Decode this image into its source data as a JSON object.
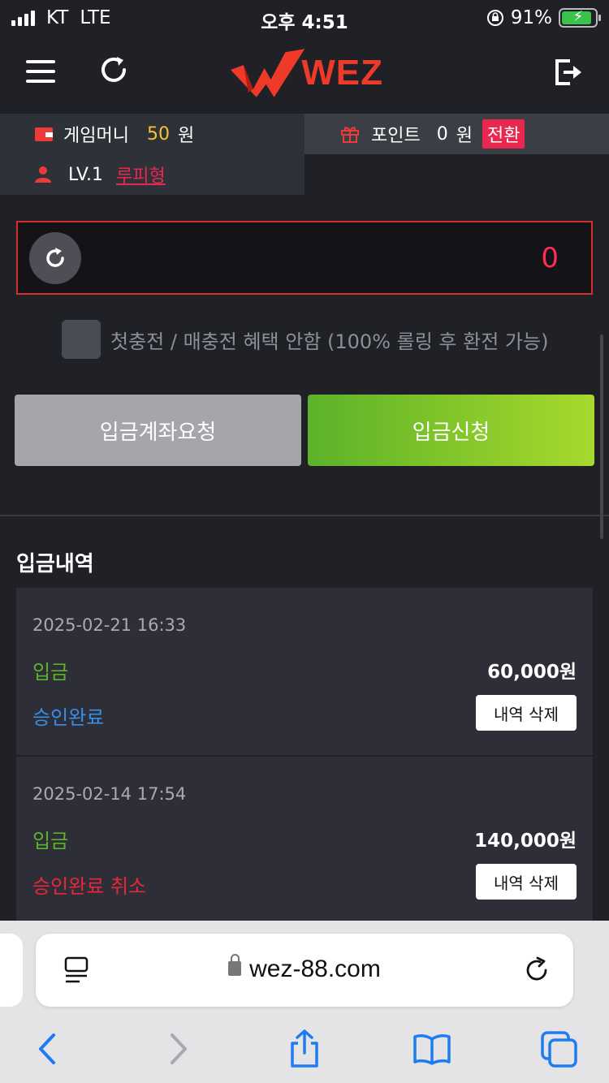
{
  "status_bar": {
    "carrier": "KT",
    "network": "LTE",
    "time": "오후 4:51",
    "battery": "91%",
    "battery_level": 0.91
  },
  "header": {
    "logo_text": "WEZ"
  },
  "account": {
    "game_money_label": "게임머니",
    "game_money_value": "50",
    "game_money_unit": "원",
    "points_label": "포인트",
    "points_value": "0",
    "points_unit": "원",
    "convert_label": "전환",
    "level": "LV.1",
    "nickname": "루피형"
  },
  "deposit_form": {
    "amount": "0",
    "bonus_text": "첫충전 / 매충전 혜택 안함 (100% 롤링 후 환전 가능)",
    "bonus_checked": false,
    "request_account_label": "입금계좌요청",
    "apply_label": "입금신청"
  },
  "history": {
    "title": "입금내역",
    "records": [
      {
        "date": "2025-02-21 16:33",
        "type": "입금",
        "amount": "60,000원",
        "status": "승인완료",
        "status_color": "#3a8ee6",
        "delete_label": "내역 삭제"
      },
      {
        "date": "2025-02-14 17:54",
        "type": "입금",
        "amount": "140,000원",
        "status": "승인완료 취소",
        "status_color": "#e8283a",
        "delete_label": "내역 삭제"
      }
    ]
  },
  "browser": {
    "url": "wez-88.com"
  },
  "colors": {
    "accent_red": "#e8284f",
    "money_yellow": "#f5c330",
    "deposit_green": "#5cb229",
    "approved_blue": "#3a8ee6",
    "ios_blue": "#1e7cf2"
  }
}
